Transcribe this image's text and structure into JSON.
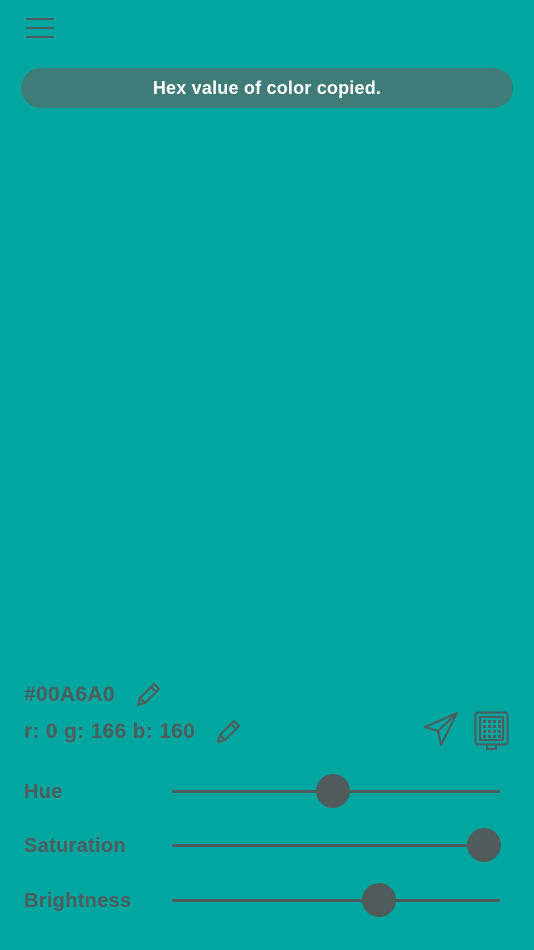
{
  "toast": {
    "message": "Hex value of color copied."
  },
  "color": {
    "hex_text": "#00A6A0",
    "rgb_text": "r: 0 g: 166 b: 160",
    "swatch": "#00A6A0"
  },
  "sliders": [
    {
      "label": "Hue",
      "value": 0.49
    },
    {
      "label": "Saturation",
      "value": 0.95
    },
    {
      "label": "Brightness",
      "value": 0.63
    }
  ],
  "icons": {
    "menu": "hamburger-menu-icon",
    "edit_hex": "pencil-icon",
    "edit_rgb": "pencil-icon",
    "share": "paper-plane-icon",
    "palette": "color-grid-icon"
  },
  "theme": {
    "foreground": "#4f5c5b",
    "toast_bg": "#3f7c78",
    "toast_text": "#ffffff"
  }
}
